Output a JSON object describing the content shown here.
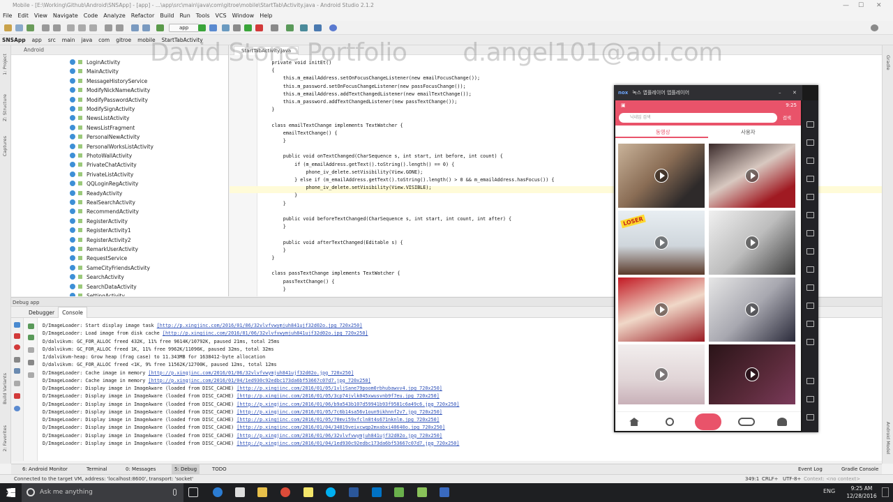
{
  "window": {
    "title": "Mobile - [E:\\Working\\Github\\Android\\SNSApp] - [app] - ...\\app\\src\\main\\java\\com\\gitroe\\mobile\\StartTab\\Activity.java - Android Studio 2.1.2"
  },
  "menu": [
    "File",
    "Edit",
    "View",
    "Navigate",
    "Code",
    "Analyze",
    "Refactor",
    "Build",
    "Run",
    "Tools",
    "VCS",
    "Window",
    "Help"
  ],
  "toolbar": {
    "run_config": "app"
  },
  "breadcrumb": [
    "SNSApp",
    "app",
    "src",
    "main",
    "java",
    "com",
    "gitroe",
    "mobile",
    "StartTabActivity"
  ],
  "project": {
    "header": "Android",
    "items": [
      "LoginActivity",
      "MainActivity",
      "MessageHistoryService",
      "ModifyNickNameActivity",
      "ModifyPasswordActivity",
      "ModifySignActivity",
      "NewsListActivity",
      "NewsListFragment",
      "PersonalNewActivity",
      "PersonalWorksListActivity",
      "PhotoWallActivity",
      "PrivateChatActivity",
      "PrivateListActivity",
      "QQLoginRegActivity",
      "ReadyActivity",
      "RealSearchActivity",
      "RecommendActivity",
      "RegisterActivity",
      "RegisterActivity1",
      "RegisterActivity2",
      "RemarkUserActivity",
      "RequestService",
      "SameCityFriendsActivity",
      "SearchActivity",
      "SearchDataActivity",
      "SettingActivity"
    ]
  },
  "editor": {
    "tab": "StartTabActivity.java",
    "lines": [
      "    private void initEt()",
      "    {",
      "        this.m_emailAddress.setOnFocusChangeListener(new emailFocusChange());",
      "        this.m_password.setOnFocusChangeListener(new passFocusChange());",
      "        this.m_emailAddress.addTextChangedListener(new emailTextChange());",
      "        this.m_password.addTextChangedListener(new passTextChange());",
      "    }",
      "",
      "    class emailTextChange implements TextWatcher {",
      "        emailTextChange() {",
      "        }",
      "",
      "        public void onTextChanged(CharSequence s, int start, int before, int count) {",
      "            if (m_emailAddress.getText().toString().length() == 0) {",
      "                phone_iv_delete.setVisibility(View.GONE);",
      "            } else if (m_emailAddress.getText().toString().length() > 0 && m_emailAddress.hasFocus()) {",
      "                phone_iv_delete.setVisibility(View.VISIBLE);",
      "            }",
      "        }",
      "",
      "        public void beforeTextChanged(CharSequence s, int start, int count, int after) {",
      "        }",
      "",
      "        public void afterTextChanged(Editable s) {",
      "        }",
      "    }",
      "",
      "    class passTextChange implements TextWatcher {",
      "        passTextChange() {",
      "        }"
    ]
  },
  "watermark": {
    "name": "David Stone Portfolio",
    "email": "d.angel101@aol.com"
  },
  "debug": {
    "bar": "Debug    app",
    "tabs": [
      "Debugger",
      "Console"
    ],
    "lines": [
      {
        "t": "D/ImageLoader: Start display image task ",
        "u": "[http://p.xingjinc.com/2016/01/06/32vlvfvwymjuh841ujf32d02o.jpg_720x250]"
      },
      {
        "t": "D/ImageLoader: Load image from disk cache ",
        "u": "[http://p.xingjinc.com/2016/01/06/32vlvfvwymjuh841ujf32d02o.jpg_720x250]"
      },
      {
        "t": "D/dalvikvm: GC_FOR_ALLOC freed 432K, 11% free 9614K/10792K, paused 21ms, total 25ms",
        "u": ""
      },
      {
        "t": "D/dalvikvm: GC_FOR_ALLOC freed 1K, 11% free 9962K/11096K, paused 32ms, total 32ms",
        "u": ""
      },
      {
        "t": "I/dalvikvm-heap: Grow heap (frag case) to 11.343MB for 1638412-byte allocation",
        "u": ""
      },
      {
        "t": "D/dalvikvm: GC_FOR_ALLOC freed <1K, 9% free 11562K/12700K, paused 12ms, total 12ms",
        "u": ""
      },
      {
        "t": "D/ImageLoader: Cache image in memory ",
        "u": "[http://p.xingjinc.com/2016/01/06/32vlvfvwymjuh841ujf32d02o.jpg_720x250]"
      },
      {
        "t": "D/ImageLoader: Cache image in memory ",
        "u": "[http://p.xingjinc.com/2016/01/04/1ed930c92edbc173da6bf53667c07d7.jpg_720x250]"
      },
      {
        "t": "D/ImageLoader: Display image in ImageAware (loaded from DISC_CACHE) ",
        "u": "[http://p.xingjinc.com/2016/01/05/1vljSane79poom0rbhubawvv4.jpg_720x250]"
      },
      {
        "t": "D/ImageLoader: Display image in ImageAware (loaded from DISC_CACHE) ",
        "u": "[http://p.xingjinc.com/2016/01/05/3cp74jvlk045xwusvnb9f7eu.jpg_720x250]"
      },
      {
        "t": "D/ImageLoader: Display image in ImageAware (loaded from DISC_CACHE) ",
        "u": "[http://p.xingjinc.com/2016/01/06/b9a543b107d59941b93f9581c6a49c6.jpg_720x250]"
      },
      {
        "t": "D/ImageLoader: Display image in ImageAware (loaded from DISC_CACHE) ",
        "u": "[http://p.xingjinc.com/2016/01/05/7c6b14sa56v1oun9ikhnnf2v7.jpg_720x250]"
      },
      {
        "t": "D/ImageLoader: Display image in ImageAware (loaded from DISC_CACHE) ",
        "u": "[http://p.xingjinc.com/2016/01/05/70mvi59xfcln8t4s671nknlm.jpg_720x250]"
      },
      {
        "t": "D/ImageLoader: Display image in ImageAware (loaded from DISC_CACHE) ",
        "u": "[http://p.xingjinc.com/2016/01/04/34819veixcwqp2mxabxi40640o.jpg_720x250]"
      },
      {
        "t": "D/ImageLoader: Display image in ImageAware (loaded from DISC_CACHE) ",
        "u": "[http://p.xingjinc.com/2016/01/06/32vlvfvwymjuh841ujf32d02o.jpg_720x250]"
      },
      {
        "t": "D/ImageLoader: Display image in ImageAware (loaded from DISC_CACHE) ",
        "u": "[http://p.xingjinc.com/2016/01/04/1ed930c92edbc173da6bf53667c07d7.jpg_720x250]"
      }
    ]
  },
  "bottom_tabs": [
    "6: Android Monitor",
    "Terminal",
    "0: Messages",
    "5: Debug",
    "TODO",
    "Event Log",
    "Gradle Console"
  ],
  "status": {
    "left": "Connected to the target VM, address: 'localhost:8600', transport: 'socket'",
    "pos": "349:1",
    "crlf": "CRLF÷",
    "enc": "UTF-8÷",
    "ctx": "Context: <no context>"
  },
  "taskbar": {
    "search_placeholder": "Ask me anything",
    "lang": "ENG",
    "time": "9:25 AM",
    "date": "12/28/2016"
  },
  "nox": {
    "title": "녹스 앱플레이어 앱플레이어",
    "logo": "nox",
    "phone": {
      "time": "9:25",
      "search_placeholder": "닉네임 검색",
      "search_btn": "검색",
      "tabs": [
        "동영상",
        "사용자"
      ]
    }
  },
  "colors": {
    "accent": "#e9536a",
    "link": "#2c4fb8"
  }
}
